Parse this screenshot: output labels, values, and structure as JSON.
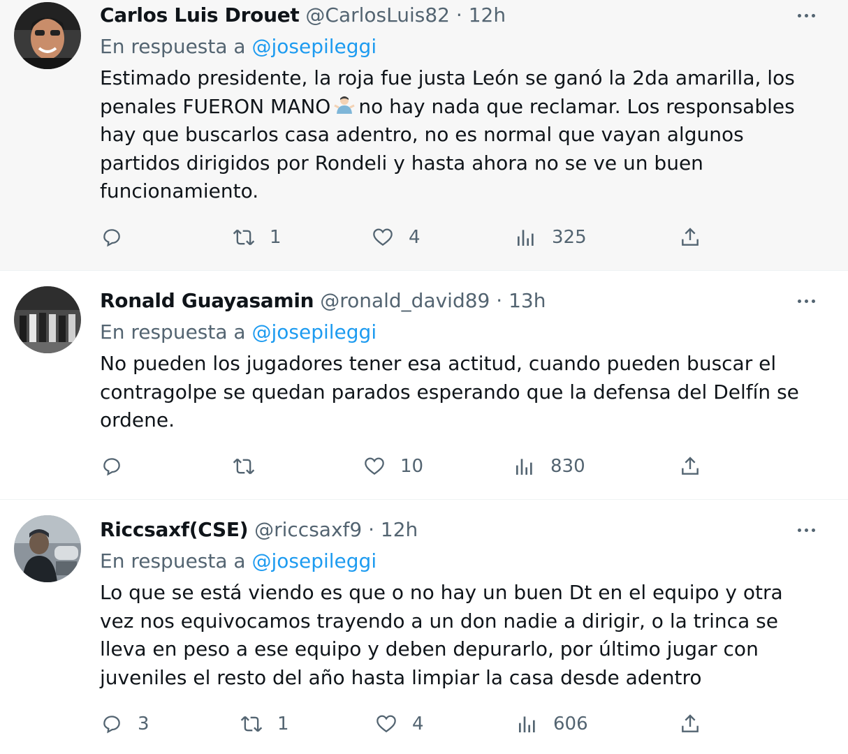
{
  "colors": {
    "link": "#1d9bf0",
    "secondary_text": "#536471",
    "primary_text": "#0f1419"
  },
  "tweets": [
    {
      "name": "Carlos Luis Drouet",
      "handle": "@CarlosLuis82",
      "time": "12h",
      "separator": "·",
      "reply_prefix": "En respuesta a",
      "reply_to": "@josepileggi",
      "text_before_emoji": "Estimado presidente, la roja fue justa León se ganó la 2da amarilla, los penales FUERON MANO",
      "emoji_icon": "man-shrugging-emoji",
      "text_after_emoji": "no hay nada que reclamar. Los responsables hay que buscarlos casa adentro, no es normal que  vayan algunos partidos dirigidos por Rondeli y hasta ahora no se ve un buen funcionamiento.",
      "replies": "",
      "retweets": "1",
      "likes": "4",
      "views": "325"
    },
    {
      "name": "Ronald Guayasamin",
      "handle": "@ronald_david89",
      "time": "13h",
      "separator": "·",
      "reply_prefix": "En respuesta a",
      "reply_to": "@josepileggi",
      "text": "No pueden los jugadores tener esa actitud, cuando pueden buscar el contragolpe se quedan parados esperando que la defensa del Delfín se ordene.",
      "replies": "",
      "retweets": "",
      "likes": "10",
      "views": "830"
    },
    {
      "name": "Riccsaxf(CSE)",
      "handle": "@riccsaxf9",
      "time": "12h",
      "separator": "·",
      "reply_prefix": "En respuesta a",
      "reply_to": "@josepileggi",
      "text": "Lo que se está viendo es que o no hay un buen Dt en el equipo y otra vez nos equivocamos trayendo a un don nadie a dirigir, o la trinca se lleva en peso a ese equipo y deben depurarlo, por último jugar con juveniles el resto del año hasta limpiar la casa desde adentro",
      "replies": "3",
      "retweets": "1",
      "likes": "4",
      "views": "606"
    }
  ],
  "icons": {
    "reply": "reply-icon",
    "retweet": "retweet-icon",
    "like": "heart-icon",
    "views": "views-icon",
    "share": "share-icon",
    "more": "more-icon"
  }
}
